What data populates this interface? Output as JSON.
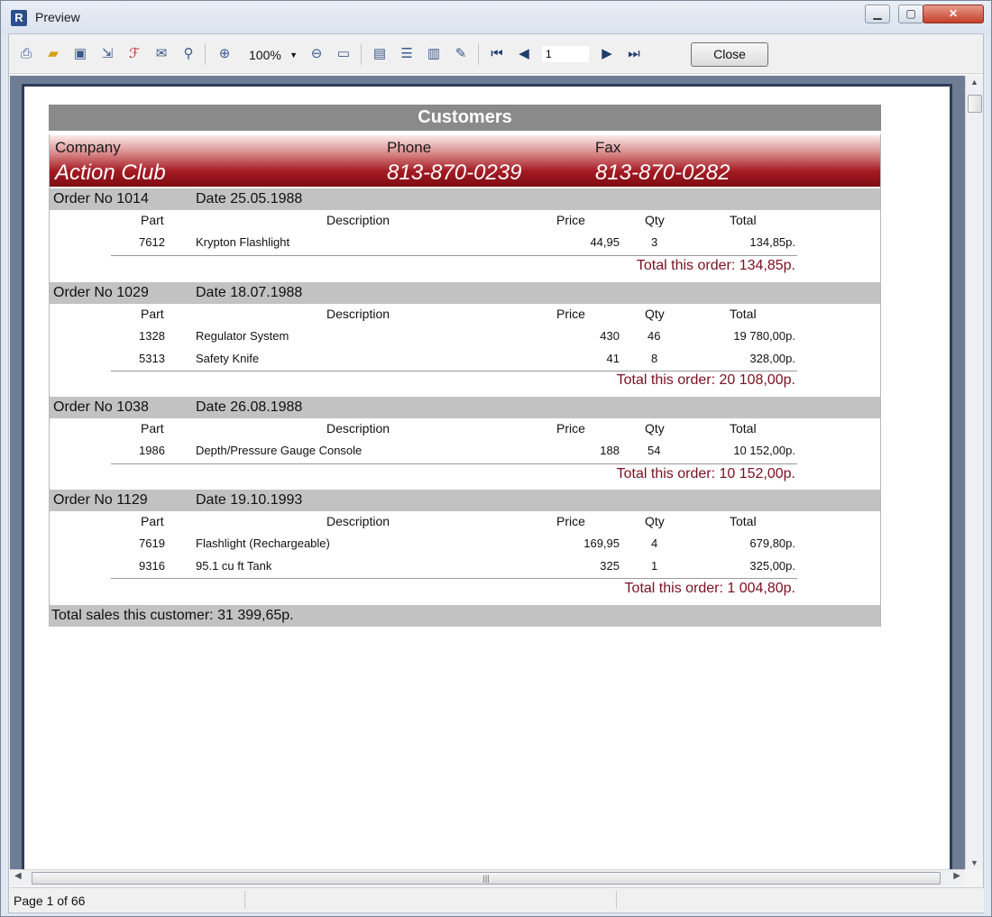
{
  "window": {
    "title": "Preview",
    "app_icon": "R"
  },
  "toolbar": {
    "icons": [
      "print-icon",
      "open-icon",
      "save-icon",
      "export-icon",
      "pdf-icon",
      "email-icon",
      "find-icon",
      "zoom-in-icon",
      "zoom-out-icon",
      "fullscreen-icon",
      "page-settings-icon",
      "outline-icon",
      "thumbnails-icon",
      "edit-icon",
      "first-page-icon",
      "prev-page-icon",
      "next-page-icon",
      "last-page-icon"
    ],
    "zoom": "100%",
    "page_input": "1",
    "close_label": "Close"
  },
  "report": {
    "title": "Customers",
    "company_label": "Company",
    "phone_label": "Phone",
    "fax_label": "Fax",
    "company": "Action Club",
    "phone": "813-870-0239",
    "fax": "813-870-0282",
    "columns": {
      "part": "Part",
      "description": "Description",
      "price": "Price",
      "qty": "Qty",
      "total": "Total"
    },
    "orders": [
      {
        "no": "Order No 1014",
        "date": "Date 25.05.1988",
        "items": [
          {
            "part": "7612",
            "description": "Krypton Flashlight",
            "price": "44,95",
            "qty": "3",
            "total": "134,85p."
          }
        ],
        "total": "Total this order: 134,85p."
      },
      {
        "no": "Order No 1029",
        "date": "Date 18.07.1988",
        "items": [
          {
            "part": "1328",
            "description": "Regulator System",
            "price": "430",
            "qty": "46",
            "total": "19 780,00p."
          },
          {
            "part": "5313",
            "description": "Safety Knife",
            "price": "41",
            "qty": "8",
            "total": "328,00p."
          }
        ],
        "total": "Total this order: 20 108,00p."
      },
      {
        "no": "Order No 1038",
        "date": "Date 26.08.1988",
        "items": [
          {
            "part": "1986",
            "description": "Depth/Pressure Gauge Console",
            "price": "188",
            "qty": "54",
            "total": "10 152,00p."
          }
        ],
        "total": "Total this order: 10 152,00p."
      },
      {
        "no": "Order No 1129",
        "date": "Date 19.10.1993",
        "items": [
          {
            "part": "7619",
            "description": "Flashlight (Rechargeable)",
            "price": "169,95",
            "qty": "4",
            "total": "679,80p."
          },
          {
            "part": "9316",
            "description": "95.1 cu ft Tank",
            "price": "325",
            "qty": "1",
            "total": "325,00p."
          }
        ],
        "total": "Total this order: 1 004,80p."
      }
    ],
    "grand_total": "Total sales this customer: 31 399,65p."
  },
  "status": {
    "page": "Page 1 of 66"
  }
}
